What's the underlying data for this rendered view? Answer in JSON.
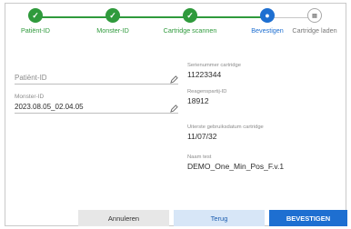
{
  "stepper": {
    "steps": [
      {
        "label": "Patiënt-ID",
        "status": "done"
      },
      {
        "label": "Monster-ID",
        "status": "done"
      },
      {
        "label": "Cartridge scannen",
        "status": "done"
      },
      {
        "label": "Bevestigen",
        "status": "active"
      },
      {
        "label": "Cartridge laden",
        "status": "pending"
      }
    ],
    "colors": {
      "done": "#2f9a3c",
      "active": "#1e6fd1",
      "pending": "#a9a9a9"
    }
  },
  "form": {
    "patient_id": {
      "placeholder": "Patiënt-ID",
      "value": ""
    },
    "sample_id": {
      "label": "Monster-ID",
      "value": "2023.08.05_02.04.05"
    }
  },
  "details": {
    "serial_label": "Serienummer cartridge",
    "serial_value": "11223344",
    "lot_label": "Reagenspartij-ID",
    "lot_value": "18912",
    "expiry_label": "Uiterste gebruiksdatum cartridge",
    "expiry_value": "11/07/32",
    "test_label": "Naam test",
    "test_value": "DEMO_One_Min_Pos_F.v.1"
  },
  "footer": {
    "cancel": "Annuleren",
    "back": "Terug",
    "confirm": "BEVESTIGEN"
  }
}
